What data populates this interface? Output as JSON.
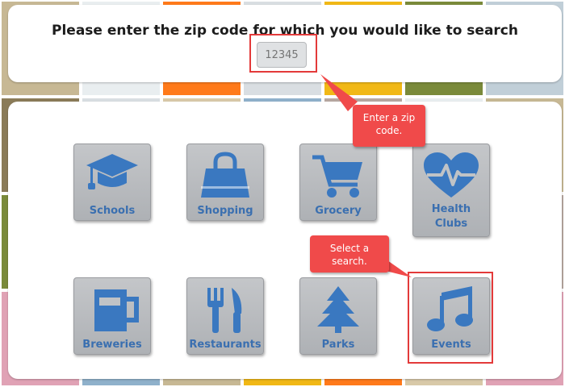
{
  "search": {
    "prompt": "Please enter the zip code for which you would like to search",
    "zip_placeholder": "12345"
  },
  "categories": [
    {
      "label": "Schools",
      "icon": "graduation-cap-icon"
    },
    {
      "label": "Shopping",
      "icon": "shopping-bag-icon"
    },
    {
      "label": "Grocery",
      "icon": "shopping-cart-icon"
    },
    {
      "label": "Health Clubs",
      "icon": "heartbeat-icon"
    },
    {
      "label": "Breweries",
      "icon": "beer-mug-icon"
    },
    {
      "label": "Restaurants",
      "icon": "fork-knife-icon"
    },
    {
      "label": "Parks",
      "icon": "pine-tree-icon"
    },
    {
      "label": "Events",
      "icon": "music-note-icon"
    }
  ],
  "callouts": {
    "zip": "Enter a zip code.",
    "search": "Select a search."
  },
  "colors": {
    "icon_blue": "#3a78c0",
    "highlight_red": "#e33a3a",
    "callout_red": "#f04a4a"
  }
}
